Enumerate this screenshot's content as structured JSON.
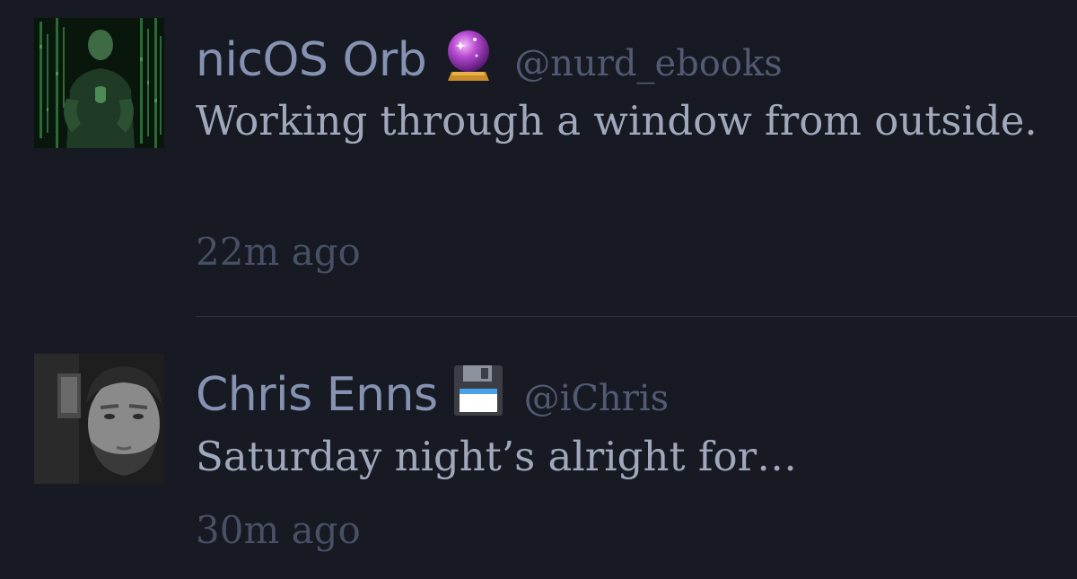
{
  "tweets": [
    {
      "display_name": "nicOS Orb",
      "emoji": "crystal-ball-icon",
      "handle": "@nurd_ebooks",
      "text": "Working through a window from outside.",
      "time": "22m ago"
    },
    {
      "display_name": "Chris Enns",
      "emoji": "floppy-disk-icon",
      "handle": "@iChris",
      "text": "Saturday night’s alright for…",
      "time": "30m ago"
    }
  ],
  "colors": {
    "background": "#171923",
    "display_name": "#8592b1",
    "handle": "#525b73",
    "body_text": "#a0a8bc",
    "timestamp": "#485065",
    "divider": "#2b2f3d"
  }
}
